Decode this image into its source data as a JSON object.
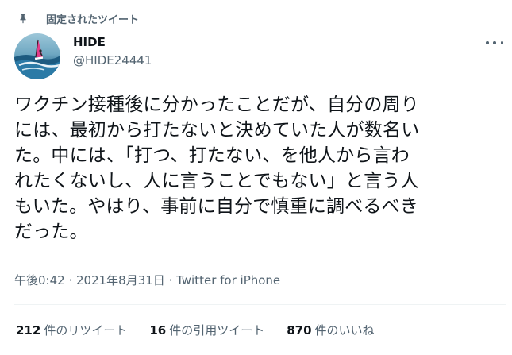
{
  "pinned_label": "固定されたツイート",
  "user": {
    "name": "HIDE",
    "handle": "@HIDE24441"
  },
  "tweet_text": "ワクチン接種後に分かったことだが、自分の周り\nには、最初から打たないと決めていた人が数名い\nた。中には、「打つ、打たない、を他人から言わ\nれたくないし、人に言うことでもない」と言う人\nもいた。やはり、事前に自分で慎重に調べるべき\nだった。",
  "meta": "午後0:42 · 2021年8月31日 · Twitter for iPhone",
  "stats": {
    "retweets_count": "212",
    "retweets_label": "件のリツイート",
    "quotes_count": "16",
    "quotes_label": "件の引用ツイート",
    "likes_count": "870",
    "likes_label": "件のいいね"
  },
  "icons": {
    "pin": "pin-icon",
    "more": "more-icon"
  },
  "colors": {
    "text_primary": "#0f1419",
    "text_secondary": "#536471",
    "divider": "#eff3f4"
  }
}
